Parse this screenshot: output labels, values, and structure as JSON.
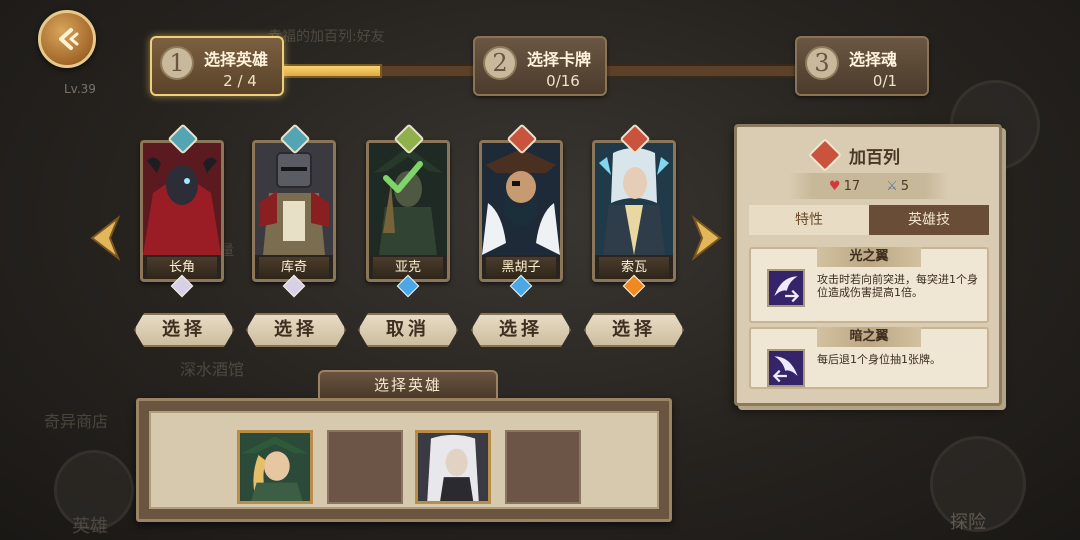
{
  "background": {
    "level": "Lv.39",
    "shop": "奇异商店",
    "tavern": "深水酒馆",
    "hero": "英雄",
    "explore": "探险",
    "friend_hint": "幸福的加百列:好友",
    "limit_hint": "限量"
  },
  "steps": [
    {
      "num": "1",
      "title": "选择英雄",
      "count": "2 / 4",
      "active": true
    },
    {
      "num": "2",
      "title": "选择卡牌",
      "count": "0/16",
      "active": false
    },
    {
      "num": "3",
      "title": "选择魂",
      "count": "0/1",
      "active": false
    }
  ],
  "step_progress": 0.2,
  "heroes": [
    {
      "name": "长角",
      "class": "teal",
      "gem": "white",
      "button": "选择",
      "selected": false
    },
    {
      "name": "库奇",
      "class": "teal",
      "gem": "white",
      "button": "选择",
      "selected": false
    },
    {
      "name": "亚克",
      "class": "green",
      "gem": "blue",
      "button": "取消",
      "selected": true
    },
    {
      "name": "黑胡子",
      "class": "red",
      "gem": "blue",
      "button": "选择",
      "selected": false
    },
    {
      "name": "索瓦",
      "class": "red",
      "gem": "orange",
      "button": "选择",
      "selected": false
    }
  ],
  "panel": {
    "name": "加百列",
    "hp": "17",
    "attack": "5",
    "tabs": [
      "特性",
      "英雄技"
    ],
    "skills": [
      {
        "title": "光之翼",
        "desc": "攻击时若向前突进，每突进1个身位造成伤害提高1倍。"
      },
      {
        "title": "暗之翼",
        "desc": "每后退1个身位抽1张牌。"
      }
    ]
  },
  "selection": {
    "title": "选择英雄",
    "slots": [
      "filled",
      "empty",
      "filled",
      "empty"
    ]
  }
}
